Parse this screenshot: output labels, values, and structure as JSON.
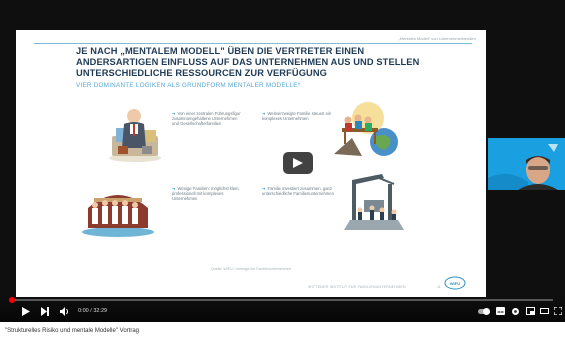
{
  "slide": {
    "header_note": "„Mentales Modell\" von Unternehmerfamilien",
    "title": "Je nach „mentalem Modell\" üben die Vertreter einen andersartigen Einfluss auf das Unternehmen aus und stellen unterschiedliche Ressourcen zur Verfügung",
    "subtitle": "Vier dominante Logiken als Grundform mentaler Modelle*",
    "quadrants": [
      {
        "text": "Von einer zentralen Führungsfigur zusammengehaltene Unternehmen und Gesellschafterfamilien"
      },
      {
        "text": "Weitverzweigte Familie steuert ein komplexes Unternehmen"
      },
      {
        "text": "Wenige Familien: möglichst klein, professionell mit komplexes Unternehmen"
      },
      {
        "text": "Familie investiert zusammen, ganz unterschiedliche Familienunternehmen"
      }
    ],
    "source": "Quelle: WIFU / Umfrage bei Familienunternehmen",
    "footer": "WITTENER INSTITUT FÜR FAMILIENUNTERNEHMEN",
    "page_number": "11",
    "logo_text": "WIFU"
  },
  "player": {
    "time_current": "0:00",
    "time_total": "32:29",
    "progress": 0.0,
    "accent_color": "#ff0000",
    "icons": [
      "play-icon",
      "next-icon",
      "volume-icon",
      "autoplay-toggle-icon",
      "subtitles-icon",
      "settings-icon",
      "miniplayer-icon",
      "theater-icon",
      "fullscreen-icon"
    ]
  },
  "caption": "\"Strukturelles Risiko und mentale Modelle\" Vortrag"
}
